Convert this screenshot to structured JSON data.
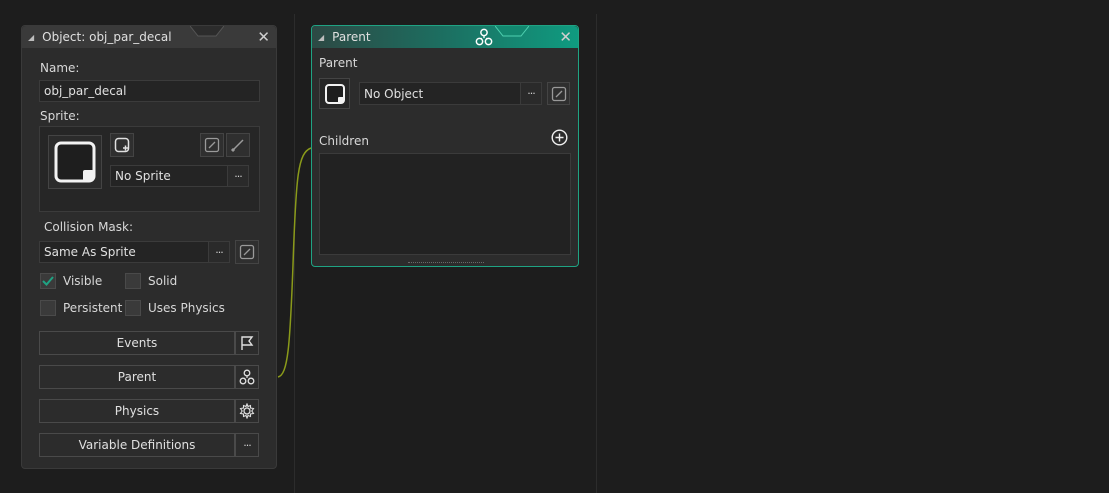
{
  "object_window": {
    "title": "Object: obj_par_decal",
    "name_label": "Name:",
    "name_value": "obj_par_decal",
    "sprite_label": "Sprite:",
    "sprite_value": "No Sprite",
    "collision_label": "Collision Mask:",
    "collision_value": "Same As Sprite",
    "checkboxes": {
      "visible": {
        "label": "Visible",
        "checked": true
      },
      "solid": {
        "label": "Solid",
        "checked": false
      },
      "persistent": {
        "label": "Persistent",
        "checked": false
      },
      "uses_physics": {
        "label": "Uses Physics",
        "checked": false
      }
    },
    "buttons": {
      "events": "Events",
      "parent": "Parent",
      "physics": "Physics",
      "variable_definitions": "Variable Definitions"
    },
    "ellipsis": "···"
  },
  "parent_window": {
    "title": "Parent",
    "parent_label": "Parent",
    "parent_value": "No Object",
    "children_label": "Children",
    "ellipsis": "···"
  },
  "colors": {
    "accent": "#1fa383",
    "connector": "#8a9a1a",
    "background": "#1d1d1d",
    "panel": "#2c2c2c"
  },
  "icons": [
    "object-icon",
    "parent-tree-icon",
    "close-icon",
    "edit-icon",
    "brush-icon",
    "new-sprite-icon",
    "flag-icon",
    "gear-icon",
    "add-circle-icon"
  ]
}
